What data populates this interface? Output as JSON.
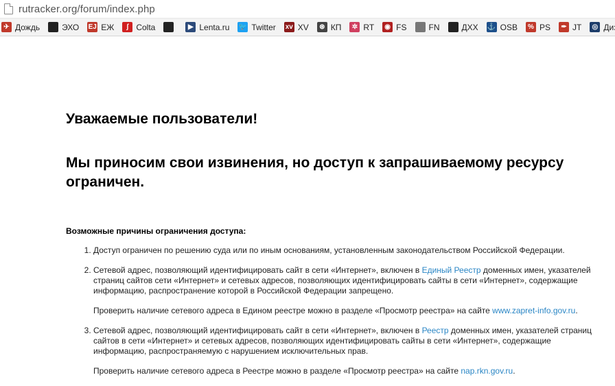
{
  "browser": {
    "url": "rutracker.org/forum/index.php"
  },
  "bookmarks": [
    {
      "label": "Дождь",
      "icon": "dozhd-icon",
      "glyph": "✈",
      "color": "#c0392b"
    },
    {
      "label": "ЭХО",
      "icon": "echo-icon",
      "glyph": "»",
      "color": "#222222"
    },
    {
      "label": "ЕЖ",
      "icon": "ej-icon",
      "glyph": "EJ",
      "color": "#c0392b"
    },
    {
      "label": "Colta",
      "icon": "colta-icon",
      "glyph": "ʃ",
      "color": "#d02020"
    },
    {
      "label": "",
      "icon": "d-icon",
      "glyph": "D",
      "color": "#222222"
    },
    {
      "label": "Lenta.ru",
      "icon": "lenta-icon",
      "glyph": "▶",
      "color": "#2c4a7a"
    },
    {
      "label": "Twitter",
      "icon": "twitter-icon",
      "glyph": "🐦",
      "color": "#1da1f2"
    },
    {
      "label": "XV",
      "icon": "xv-icon",
      "glyph": "xv",
      "color": "#8b1a1a"
    },
    {
      "label": "КП",
      "icon": "kp-icon",
      "glyph": "⊛",
      "color": "#444444"
    },
    {
      "label": "RT",
      "icon": "rt-icon",
      "glyph": "✲",
      "color": "#d04060"
    },
    {
      "label": "FS",
      "icon": "fs-icon",
      "glyph": "◉",
      "color": "#b02020"
    },
    {
      "label": "FN",
      "icon": "fn-icon",
      "glyph": "▯",
      "color": "#777777"
    },
    {
      "label": "ДХХ",
      "icon": "dxx-icon",
      "glyph": "XX",
      "color": "#222222"
    },
    {
      "label": "OSB",
      "icon": "osb-icon",
      "glyph": "⚓",
      "color": "#1d4f8a"
    },
    {
      "label": "PS",
      "icon": "ps-icon",
      "glyph": "%",
      "color": "#c0392b"
    },
    {
      "label": "JT",
      "icon": "jt-icon",
      "glyph": "✒",
      "color": "#c0392b"
    },
    {
      "label": "Диза",
      "icon": "diza-icon",
      "glyph": "◎",
      "color": "#1d3d6a"
    }
  ],
  "page": {
    "greeting": "Уважаемые пользователи!",
    "apology": "Мы приносим свои извинения, но доступ к запрашиваемому ресурсу ограничен.",
    "reasons_title": "Возможные причины ограничения доступа:",
    "reasons": [
      {
        "text_before": "Доступ ограничен  по решению суда или по иным основаниям, установленным законодательством Российской Федерации.",
        "link": "",
        "text_after": "",
        "check_before": "",
        "check_link": "",
        "check_after": ""
      },
      {
        "text_before": "Сетевой адрес, позволяющий идентифицировать сайт в сети «Интернет», включен в ",
        "link": "Единый Реестр",
        "text_after": " доменных имен, указателей страниц сайтов сети «Интернет» и сетевых адресов, позволяющих идентифицировать сайты в сети «Интернет», содержащие информацию, распространение которой в Российской Федерации запрещено.",
        "check_before": "Проверить наличие сетевого адреса в Едином реестре можно в разделе «Просмотр реестра» на сайте ",
        "check_link": "www.zapret-info.gov.ru",
        "check_after": "."
      },
      {
        "text_before": "Сетевой адрес, позволяющий идентифицировать сайт в сети «Интернет», включен в ",
        "link": "Реестр",
        "text_after": " доменных имен, указателей страниц сайтов в сети «Интернет» и сетевых адресов, позволяющих идентифицировать сайты в сети «Интернет», содержащие информацию, распространяемую с нарушением исключительных прав.",
        "check_before": "Проверить наличие сетевого адреса в Реестре можно в разделе «Просмотр реестра» на сайте ",
        "check_link": "nap.rkn.gov.ru",
        "check_after": "."
      }
    ]
  }
}
